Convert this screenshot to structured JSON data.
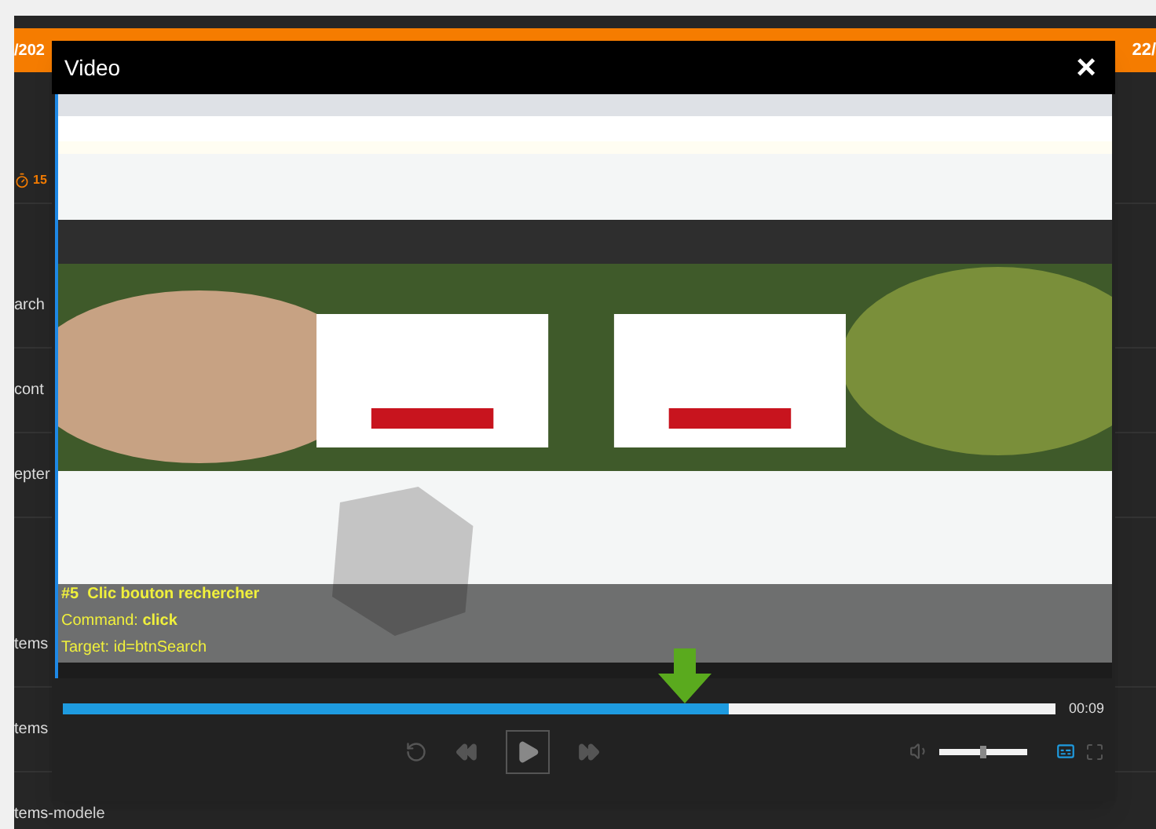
{
  "background": {
    "date_left": "/202",
    "date_right": "22/",
    "timer": "15",
    "row_groups": [
      [
        "arch",
        "cont",
        "epter"
      ],
      [
        "tems",
        "tems",
        "tems-modele"
      ]
    ]
  },
  "modal": {
    "title": "Video",
    "close": "×",
    "caption": [
      "#5  Clic bouton rechercher",
      "Command: **click**",
      "Target: id=btnSearch"
    ],
    "player": {
      "level": 0.67,
      "time": "00:09",
      "volume": {
        "level": 0.5
      },
      "captions_on": true,
      "playing": false
    }
  }
}
